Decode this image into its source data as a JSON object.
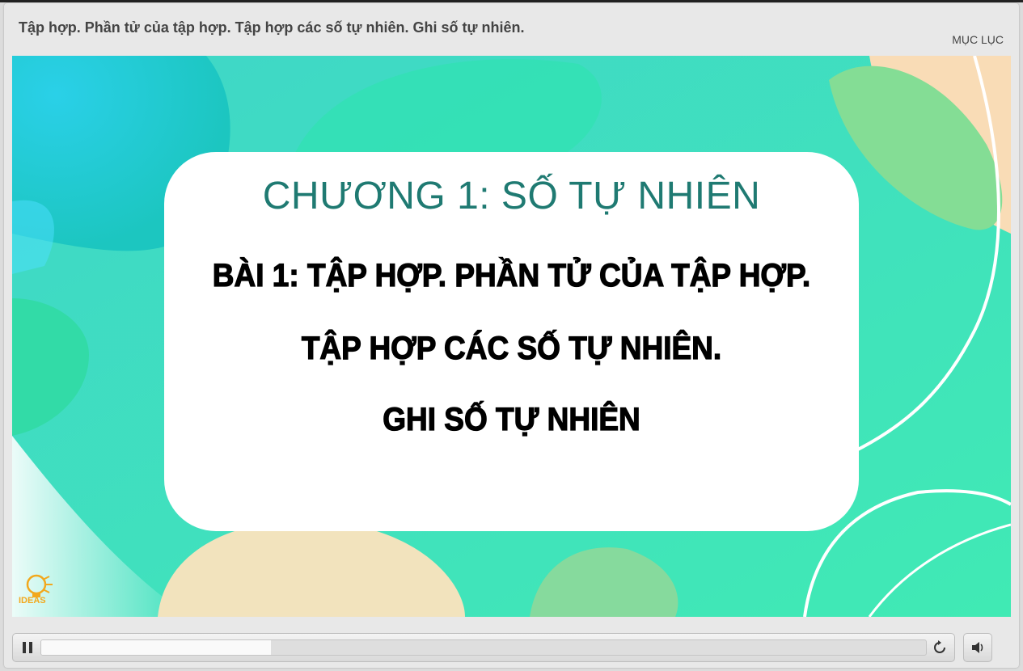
{
  "header": {
    "lesson_title": "Tập hợp. Phần tử của tập hợp. Tập hợp các số tự nhiên. Ghi số tự nhiên.",
    "menu_label": "MỤC LỤC"
  },
  "slide": {
    "chapter_title": "CHƯƠNG 1: SỐ TỰ NHIÊN",
    "lesson_lines": [
      "BÀI 1: TẬP HỢP. PHẦN TỬ CỦA TẬP HỢP.",
      "TẬP HỢP CÁC SỐ TỰ NHIÊN.",
      "GHI SỐ TỰ NHIÊN"
    ],
    "logo": {
      "icon": "lightbulb-logo-icon",
      "text": "IDEAS"
    }
  },
  "player": {
    "progress_fraction": 0.26,
    "icons": {
      "pause": "pause-icon",
      "replay": "replay-icon",
      "volume": "volume-icon"
    }
  },
  "colors": {
    "slide_teal": "#3ee6b8",
    "chapter_text": "#1f7a72",
    "logo_orange": "#f2a81d"
  }
}
